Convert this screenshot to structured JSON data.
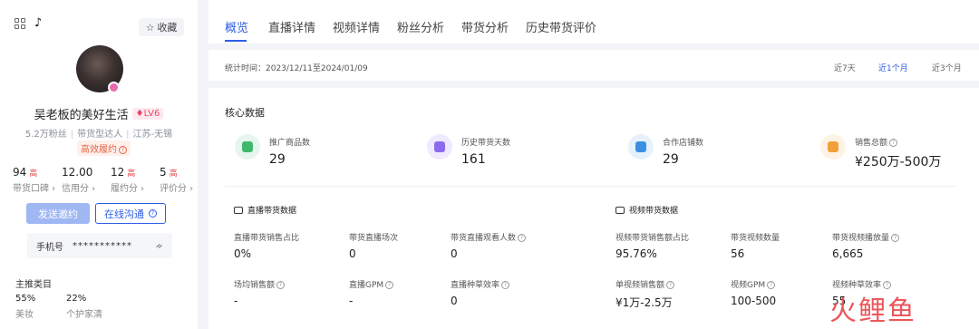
{
  "profile": {
    "favorite_label": "收藏",
    "name": "吴老板的美好生活",
    "level": "LV6",
    "fans": "5.2万粉丝",
    "type": "带货型达人",
    "location": "江苏-无锡",
    "tag": "高效履约",
    "stats": [
      {
        "value": "94",
        "grade": "高",
        "label": "带货口碑"
      },
      {
        "value": "12.00",
        "grade": "",
        "label": "信用分"
      },
      {
        "value": "12",
        "grade": "高",
        "label": "履约分"
      },
      {
        "value": "5",
        "grade": "高",
        "label": "评价分"
      }
    ],
    "send_invite": "发送邀约",
    "online_chat": "在线沟通",
    "phone_label": "手机号",
    "phone_value": "***********",
    "categories_title": "主推类目",
    "categories": [
      {
        "value": "55%",
        "label": "美妆"
      },
      {
        "value": "22%",
        "label": "个护家清"
      }
    ]
  },
  "tabs": [
    "概览",
    "直播详情",
    "视频详情",
    "粉丝分析",
    "带货分析",
    "历史带货评价"
  ],
  "date": {
    "text": "统计时间：2023/12/11至2024/01/09",
    "ranges": [
      "近7天",
      "近1个月",
      "近3个月"
    ]
  },
  "core": {
    "title": "核心数据",
    "kpis": [
      {
        "label": "推广商品数",
        "value": "29",
        "color": "#3fb86b",
        "bg": "#e6f6ec"
      },
      {
        "label": "历史带货天数",
        "value": "161",
        "color": "#8b6cf0",
        "bg": "#efeafd"
      },
      {
        "label": "合作店铺数",
        "value": "29",
        "color": "#3a8fe0",
        "bg": "#e6f1fc"
      },
      {
        "label": "销售总额",
        "value": "¥250万-500万",
        "color": "#f2a13a",
        "bg": "#fdf3e4"
      }
    ]
  },
  "live": {
    "title": "直播带货数据",
    "metrics": [
      {
        "label": "直播带货销售占比",
        "value": "0%"
      },
      {
        "label": "带货直播场次",
        "value": "0"
      },
      {
        "label": "带货直播观看人数",
        "value": "0"
      },
      {
        "label": "场均销售额",
        "value": "-"
      },
      {
        "label": "直播GPM",
        "value": "-"
      },
      {
        "label": "直播种草效率",
        "value": "0"
      }
    ]
  },
  "video": {
    "title": "视频带货数据",
    "metrics": [
      {
        "label": "视频带货销售额占比",
        "value": "95.76%"
      },
      {
        "label": "带货视频数量",
        "value": "56"
      },
      {
        "label": "带货视频播放量",
        "value": "6,665"
      },
      {
        "label": "单视频销售额",
        "value": "¥1万-2.5万"
      },
      {
        "label": "视频GPM",
        "value": "100-500"
      },
      {
        "label": "视频种草效率",
        "value": "55"
      }
    ]
  },
  "watermark": "火鲤鱼"
}
